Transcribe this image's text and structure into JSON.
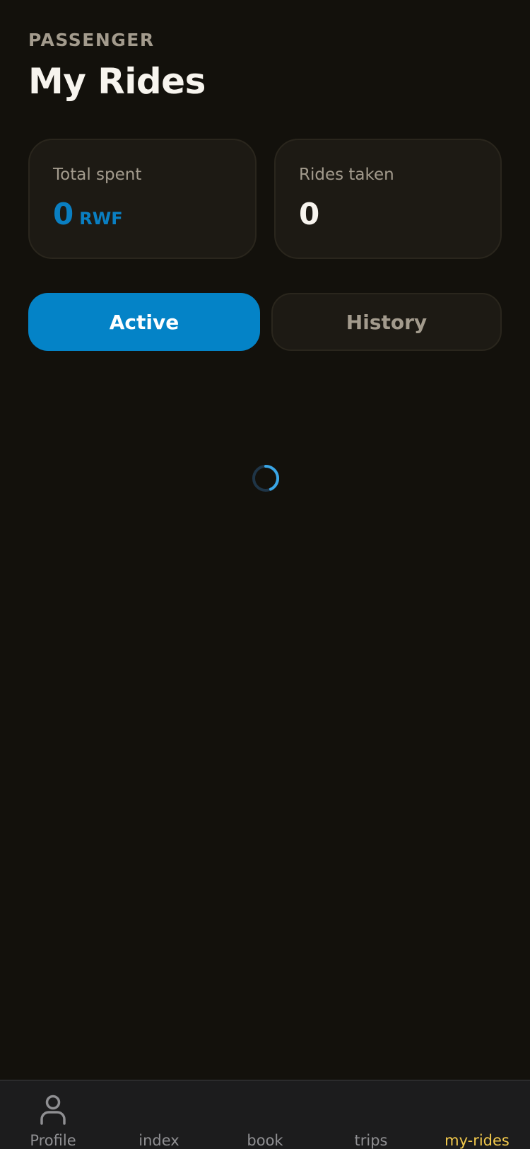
{
  "header": {
    "eyebrow": "PASSENGER",
    "title": "My Rides"
  },
  "stats": {
    "total_spent": {
      "label": "Total spent",
      "value": "0",
      "unit": "RWF"
    },
    "rides_taken": {
      "label": "Rides taken",
      "value": "0"
    }
  },
  "tabs": {
    "active": {
      "label": "Active",
      "selected": true
    },
    "history": {
      "label": "History",
      "selected": false
    }
  },
  "loading": {
    "indicator": "spinner-icon"
  },
  "bottom_nav": {
    "items": [
      {
        "label": "Profile",
        "icon": "user-icon"
      },
      {
        "label": "index"
      },
      {
        "label": "book"
      },
      {
        "label": "trips"
      },
      {
        "label": "my-rides",
        "active": true
      }
    ]
  },
  "colors": {
    "background": "#13110c",
    "card": "#1d1a14",
    "accent": "#0483c7",
    "nav_active": "#f2c94c",
    "muted": "#a39b8d"
  }
}
